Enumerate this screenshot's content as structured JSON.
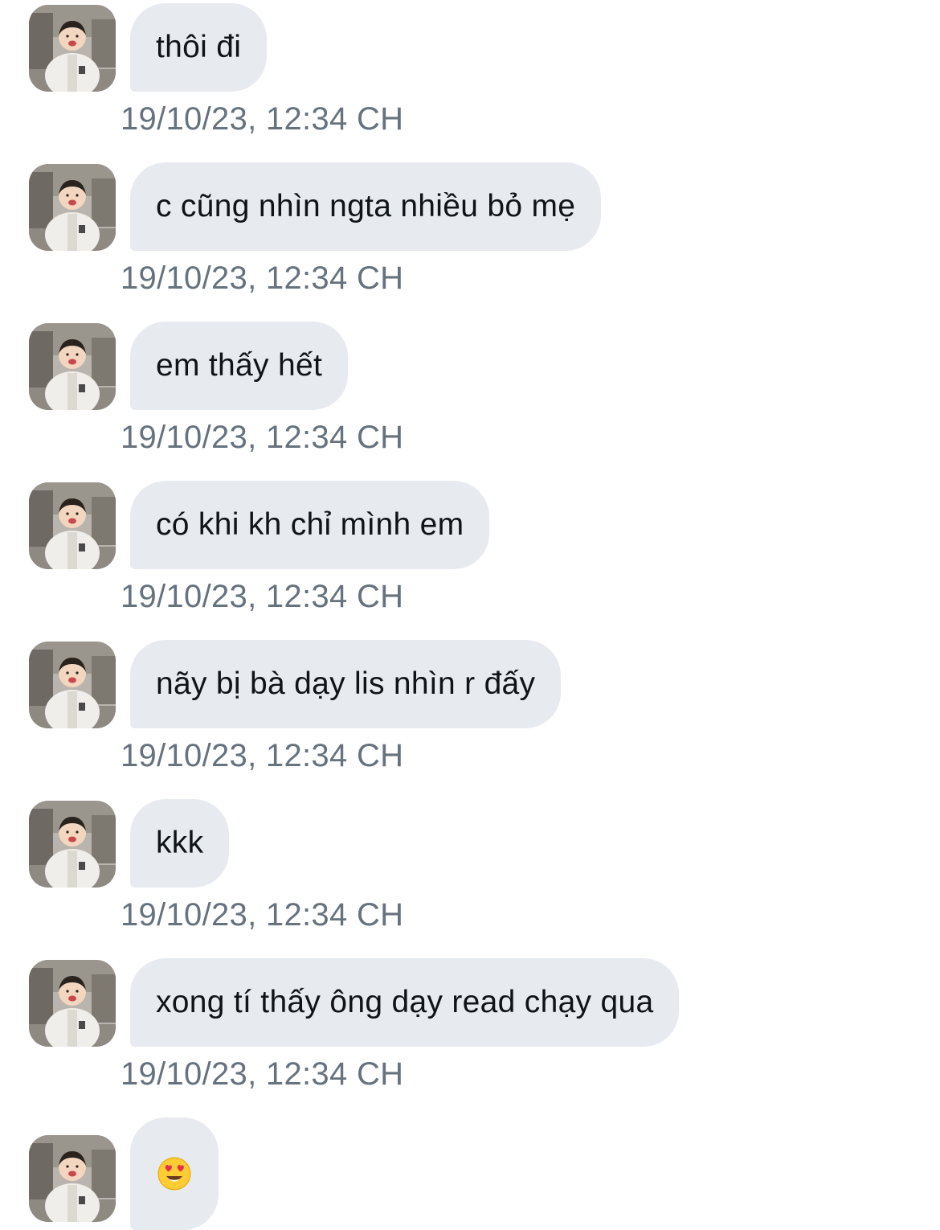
{
  "messages": [
    {
      "text": "thôi đi",
      "time": "19/10/23, 12:34 CH"
    },
    {
      "text": "c cũng nhìn ngta nhiều bỏ mẹ",
      "time": "19/10/23, 12:34 CH"
    },
    {
      "text": "em thấy hết",
      "time": "19/10/23, 12:34 CH"
    },
    {
      "text": "có khi kh chỉ mình em",
      "time": "19/10/23, 12:34 CH"
    },
    {
      "text": "nãy bị bà dạy lis nhìn r đấy",
      "time": "19/10/23, 12:34 CH"
    },
    {
      "text": "kkk",
      "time": "19/10/23, 12:34 CH"
    },
    {
      "text": "xong tí thấy ông dạy read chạy qua",
      "time": "19/10/23, 12:34 CH"
    },
    {
      "emoji": "smiling-face-with-heart-eyes"
    }
  ],
  "colors": {
    "bubble_bg": "#e7ebef",
    "text": "#0f1419",
    "timestamp": "#66727e"
  },
  "icons": {
    "avatar": "profile-photo-child",
    "last_message": "heart-eyes-emoji"
  }
}
